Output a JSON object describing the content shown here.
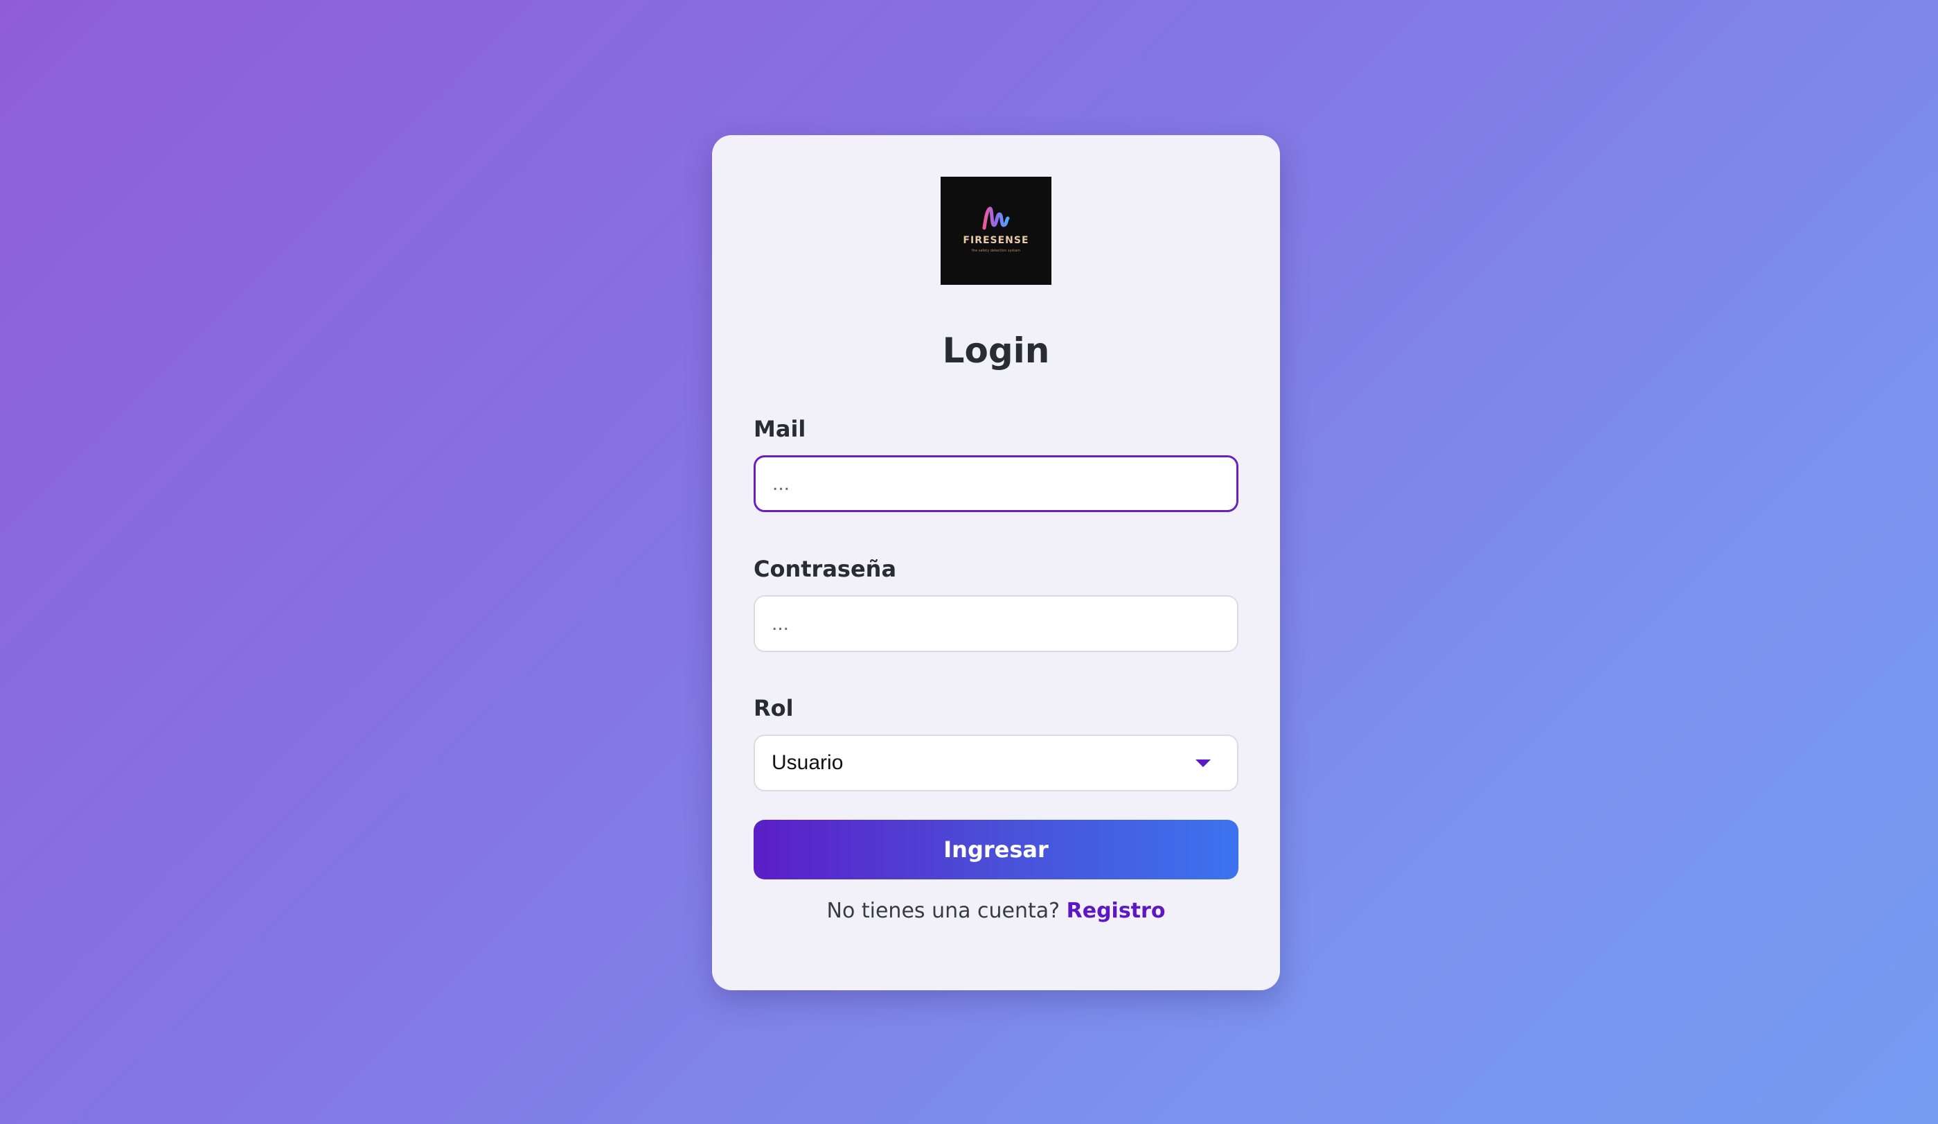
{
  "logo": {
    "brand": "FIRESENSE",
    "tagline": "fire safety detection system",
    "colors": [
      "#f05a9a",
      "#8b6cf0",
      "#4fa8ff"
    ]
  },
  "form": {
    "title": "Login",
    "mail": {
      "label": "Mail",
      "placeholder": "...",
      "value": ""
    },
    "password": {
      "label": "Contraseña",
      "placeholder": "...",
      "value": ""
    },
    "role": {
      "label": "Rol",
      "selected": "Usuario"
    },
    "submit_label": "Ingresar"
  },
  "footer": {
    "prompt": "No tienes una cuenta?",
    "link": "Registro"
  },
  "colors": {
    "accent": "#5b18c4",
    "button_gradient": [
      "#5b1ec7",
      "#3c73ee"
    ],
    "card_bg": "#f2f1fa"
  }
}
